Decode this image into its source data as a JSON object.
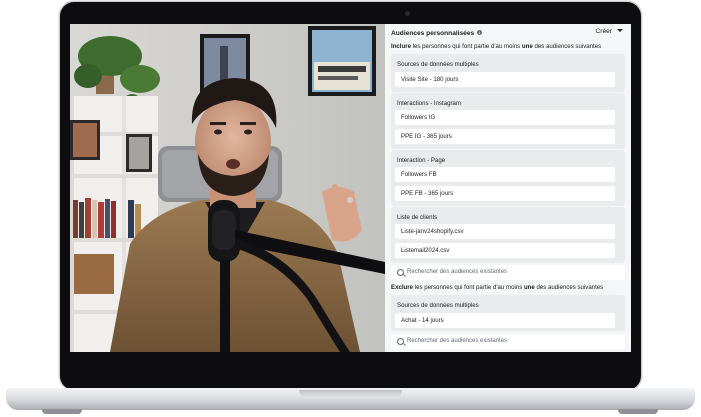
{
  "panel": {
    "title": "Audiences personnalisées",
    "create_label": "Créer",
    "include_rule": {
      "prefix": "Inclure",
      "middle": " les personnes qui font partie d'au moins ",
      "bold": "une",
      "suffix": " des audiences suivantes"
    },
    "include_groups": [
      {
        "title": "Sources de données multiples",
        "items": [
          "Visite Site - 180 jours"
        ]
      },
      {
        "title": "Interactions - Instagram",
        "items": [
          "Followers IG",
          "PPE IG - 365 jours"
        ]
      },
      {
        "title": "Interaction - Page",
        "items": [
          "Followers FB",
          "PPE FB - 365 jours"
        ]
      },
      {
        "title": "Liste de clients",
        "items": [
          "Liste-janv24shopify.csv",
          "Listemail2024.csv"
        ]
      }
    ],
    "search_placeholder": "Rechercher des audiences existantes",
    "exclude_rule": {
      "prefix": "Exclure",
      "middle": " les personnes qui font partie d'au moins ",
      "bold": "une",
      "suffix": " des audiences suivantes"
    },
    "exclude_groups": [
      {
        "title": "Sources de données multiples",
        "items": [
          "Achat - 14 jours"
        ]
      }
    ]
  },
  "colors": {
    "panel_bg": "#f5f6f7",
    "group_bg": "#eaebed",
    "laptop_frame": "#0d0d0f"
  }
}
